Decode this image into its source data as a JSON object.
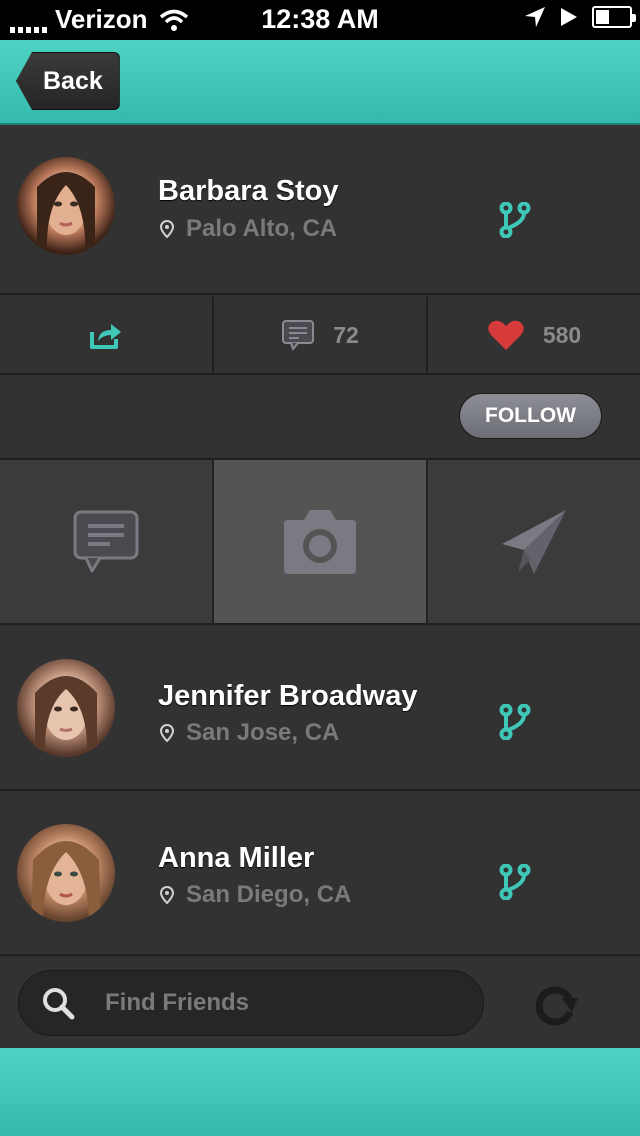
{
  "status_bar": {
    "carrier": "Verizon",
    "time": "12:38 AM",
    "battery_level": 0.4
  },
  "nav": {
    "back_label": "Back"
  },
  "profile": {
    "name": "Barbara Stoy",
    "location": "Palo Alto, CA"
  },
  "stats": {
    "comments": "72",
    "likes": "580"
  },
  "follow_label": "FOLLOW",
  "actions": [
    {
      "icon": "message-icon"
    },
    {
      "icon": "camera-icon",
      "active": true
    },
    {
      "icon": "paper-plane-icon"
    }
  ],
  "friends": [
    {
      "name": "Jennifer Broadway",
      "location": "San Jose, CA"
    },
    {
      "name": "Anna Miller",
      "location": "San Diego, CA"
    }
  ],
  "search": {
    "placeholder": "Find Friends"
  },
  "colors": {
    "accent": "#3fc7b8",
    "heart": "#d63a3a",
    "background": "#323233"
  }
}
